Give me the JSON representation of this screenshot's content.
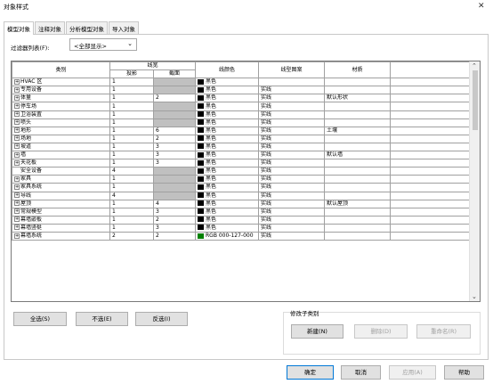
{
  "window": {
    "title": "对象样式",
    "close_glyph": "✕"
  },
  "tabs": [
    "模型对象",
    "注释对象",
    "分析模型对象",
    "导入对象"
  ],
  "filter": {
    "label": "过滤器列表(F):",
    "value": "<全部显示>"
  },
  "grid": {
    "headers": {
      "category": "类别",
      "line_weight": "线宽",
      "projection": "投影",
      "cut": "截面",
      "line_color": "线颜色",
      "line_pattern": "线型图案",
      "material": "材质"
    },
    "rows": [
      {
        "name": "HVAC 区",
        "expand": "+",
        "proj": "1",
        "cut": "",
        "cut_gray": true,
        "color": "黑色",
        "swatch": "#000000",
        "pattern": "",
        "material": ""
      },
      {
        "name": "专用设备",
        "expand": "+",
        "proj": "1",
        "cut": "",
        "cut_gray": true,
        "color": "黑色",
        "swatch": "#000000",
        "pattern": "实线",
        "material": ""
      },
      {
        "name": "体量",
        "expand": "+",
        "proj": "1",
        "cut": "2",
        "cut_gray": false,
        "color": "黑色",
        "swatch": "#000000",
        "pattern": "实线",
        "material": "默认形状"
      },
      {
        "name": "停车场",
        "expand": "+",
        "proj": "1",
        "cut": "",
        "cut_gray": true,
        "color": "黑色",
        "swatch": "#000000",
        "pattern": "实线",
        "material": ""
      },
      {
        "name": "卫浴装置",
        "expand": "+",
        "proj": "1",
        "cut": "",
        "cut_gray": true,
        "color": "黑色",
        "swatch": "#000000",
        "pattern": "实线",
        "material": ""
      },
      {
        "name": "喷头",
        "expand": "+",
        "proj": "1",
        "cut": "",
        "cut_gray": true,
        "color": "黑色",
        "swatch": "#000000",
        "pattern": "实线",
        "material": ""
      },
      {
        "name": "地形",
        "expand": "+",
        "proj": "1",
        "cut": "6",
        "cut_gray": false,
        "color": "黑色",
        "swatch": "#000000",
        "pattern": "实线",
        "material": "土壤"
      },
      {
        "name": "场地",
        "expand": "+",
        "proj": "1",
        "cut": "2",
        "cut_gray": false,
        "color": "黑色",
        "swatch": "#000000",
        "pattern": "实线",
        "material": ""
      },
      {
        "name": "坡道",
        "expand": "+",
        "proj": "1",
        "cut": "3",
        "cut_gray": false,
        "color": "黑色",
        "swatch": "#000000",
        "pattern": "实线",
        "material": ""
      },
      {
        "name": "墙",
        "expand": "+",
        "proj": "1",
        "cut": "3",
        "cut_gray": false,
        "color": "黑色",
        "swatch": "#000000",
        "pattern": "实线",
        "material": "默认墙"
      },
      {
        "name": "天花板",
        "expand": "+",
        "proj": "1",
        "cut": "3",
        "cut_gray": false,
        "color": "黑色",
        "swatch": "#000000",
        "pattern": "实线",
        "material": ""
      },
      {
        "name": "安全设备",
        "expand": "",
        "proj": "4",
        "cut": "",
        "cut_gray": true,
        "color": "黑色",
        "swatch": "#000000",
        "pattern": "实线",
        "material": ""
      },
      {
        "name": "家具",
        "expand": "+",
        "proj": "1",
        "cut": "",
        "cut_gray": true,
        "color": "黑色",
        "swatch": "#000000",
        "pattern": "实线",
        "material": ""
      },
      {
        "name": "家具系统",
        "expand": "+",
        "proj": "1",
        "cut": "",
        "cut_gray": true,
        "color": "黑色",
        "swatch": "#000000",
        "pattern": "实线",
        "material": ""
      },
      {
        "name": "导线",
        "expand": "+",
        "proj": "4",
        "cut": "",
        "cut_gray": true,
        "color": "黑色",
        "swatch": "#000000",
        "pattern": "实线",
        "material": ""
      },
      {
        "name": "屋顶",
        "expand": "+",
        "proj": "1",
        "cut": "4",
        "cut_gray": false,
        "color": "黑色",
        "swatch": "#000000",
        "pattern": "实线",
        "material": "默认屋顶"
      },
      {
        "name": "常规模型",
        "expand": "+",
        "proj": "1",
        "cut": "3",
        "cut_gray": false,
        "color": "黑色",
        "swatch": "#000000",
        "pattern": "实线",
        "material": ""
      },
      {
        "name": "幕墙嵌板",
        "expand": "+",
        "proj": "1",
        "cut": "2",
        "cut_gray": false,
        "color": "黑色",
        "swatch": "#000000",
        "pattern": "实线",
        "material": ""
      },
      {
        "name": "幕墙竖梃",
        "expand": "+",
        "proj": "1",
        "cut": "3",
        "cut_gray": false,
        "color": "黑色",
        "swatch": "#000000",
        "pattern": "实线",
        "material": ""
      },
      {
        "name": "幕墙系统",
        "expand": "+",
        "proj": "2",
        "cut": "2",
        "cut_gray": false,
        "color": "RGB 000-127-000",
        "swatch": "#008000",
        "pattern": "实线",
        "material": ""
      }
    ]
  },
  "scrollbar": {
    "up": "⌃",
    "down": "⌄"
  },
  "buttons": {
    "select_all": "全选(S)",
    "select_none": "不选(E)",
    "invert": "反选(I)",
    "new": "新建(N)",
    "delete": "删除(D)",
    "rename": "重命名(R)",
    "ok": "确定",
    "cancel": "取消",
    "apply": "应用(A)",
    "help": "帮助"
  },
  "subcategory_group": {
    "label": "修改子类别"
  }
}
